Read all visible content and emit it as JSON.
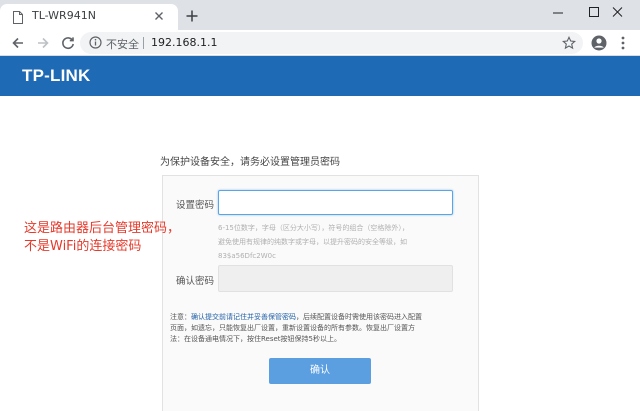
{
  "browser": {
    "tab": {
      "title": "TL-WR941N"
    },
    "address_bar": {
      "security_label": "不安全",
      "url": "192.168.1.1"
    }
  },
  "icons": {
    "favicon": "page-icon",
    "close_tab": "close-icon",
    "new_tab": "plus-icon",
    "back": "arrow-left-icon",
    "forward": "arrow-right-icon",
    "reload": "reload-icon",
    "info": "info-icon",
    "bookmark": "star-icon",
    "account": "account-icon",
    "menu": "kebab-menu-icon"
  },
  "page": {
    "brand": "TP-LINK",
    "intro": "为保护设备安全，请务必设置管理员密码",
    "form": {
      "password_label": "设置密码",
      "password_value": "",
      "hint_lines": [
        "6-15位数字，字母（区分大小写），符号的组合（空格除外），",
        "避免使用有规律的纯数字或字母，以提升密码的安全等级，如",
        "83$a56Dfc2W0c"
      ],
      "confirm_label": "确认密码",
      "confirm_value": "",
      "note": {
        "prefix": "注意：",
        "link": "确认提交前请记住并妥善保管密码",
        "line1_rest": "，后续配置设备时需使用该密码进入配置",
        "line2": "页面，如遗忘，只能恢复出厂设置，重新设置设备的所有参数。恢复出厂设置方",
        "line3": "法：在设备通电情况下，按住Reset按钮保持5秒以上。"
      },
      "submit_label": "确认"
    }
  },
  "annotation": {
    "line1": "这是路由器后台管理密码，",
    "line2": "不是WiFi的连接密码"
  },
  "colors": {
    "brand_bar": "#1f6ab5",
    "button": "#5c9fe0",
    "annotation": "#e53a2b",
    "tabstrip": "#dee1e6"
  }
}
